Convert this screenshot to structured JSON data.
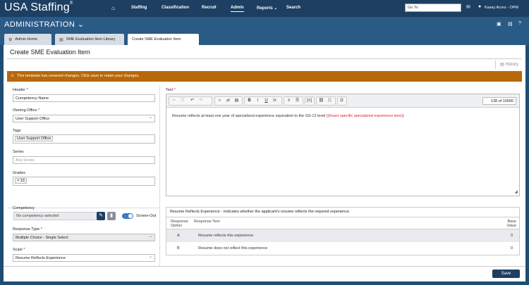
{
  "app": {
    "logo": "USA Staffing",
    "logo_mark": "®"
  },
  "nav": {
    "items": [
      "Staffing",
      "Classification",
      "Recruit",
      "Admin",
      "Reports",
      "Search"
    ],
    "reports_caret": "⌄",
    "goto_placeholder": "Go To",
    "user": "Kasey Acres - OPM"
  },
  "admin": {
    "title": "ADMINISTRATION",
    "caret": "⌄"
  },
  "tabs": [
    {
      "label": "Admin Home"
    },
    {
      "label": "SME Evaluation Item Library"
    },
    {
      "label": "Create SME Evaluation Item"
    }
  ],
  "page": {
    "title": "Create SME Evaluation Item",
    "history": "History",
    "warning": "This template has unsaved changes. Click save to retain your changes."
  },
  "form": {
    "header_label": "Header",
    "header_value": "Competency Name",
    "owning_office_label": "Owning Office",
    "owning_office_value": "User Support Office",
    "tags_label": "Tags",
    "tags_chip": "User Support Office",
    "series_label": "Series",
    "series_placeholder": "Any Series",
    "grades_label": "Grades",
    "grades_chip_x": "×",
    "grades_chip_value": "13",
    "competency_label": "Competency",
    "competency_value": "No competency selected",
    "screen_out_label": "Screen-Out",
    "response_type_label": "Response Type",
    "response_type_value": "Multiple Choice - Single Select",
    "scale_label": "Scale",
    "scale_value": "Resume Reflects Experience",
    "required_mark": "*"
  },
  "editor": {
    "label": "Text",
    "counter_value": "138",
    "counter_of": "of",
    "counter_max": "10000",
    "body_text": "Resume reflects at least one year of specialized experience equivalent to the GS-12 level",
    "placeholder_token": "{{Insert specific specialized experience item}}"
  },
  "response": {
    "title": "Resume Reflects Experience  -  Indicates whether the applicant's resume reflects the required experience.",
    "headers": {
      "option": "Response Option",
      "text": "Response Text",
      "value": "Base Value"
    },
    "rows": [
      {
        "option": "A",
        "text": "Resume reflects this experience",
        "value": "0"
      },
      {
        "option": "B",
        "text": "Resume does not reflect this experience",
        "value": "0"
      }
    ]
  },
  "actions": {
    "save": "Save"
  },
  "icons": [
    "home-icon",
    "mail-icon",
    "user-icon",
    "briefcase-icon",
    "chat-icon",
    "help-icon",
    "gear-icon",
    "document-icon",
    "history-icon",
    "warning-icon",
    "edit-icon",
    "trash-icon"
  ],
  "colors": {
    "nav": "#1c3f62",
    "header": "#2a5a86",
    "warning": "#b8680a",
    "toggle": "#3a7dbf",
    "save": "#1c3f62"
  }
}
